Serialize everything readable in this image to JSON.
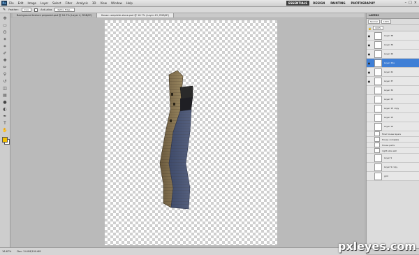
{
  "menubar": {
    "logo": "Ps",
    "items": [
      "File",
      "Edit",
      "Image",
      "Layer",
      "Select",
      "Filter",
      "Analysis",
      "3D",
      "View",
      "Window",
      "Help"
    ],
    "workspaces": [
      "ESSENTIALS",
      "DESIGN",
      "PAINTING",
      "PHOTOGRAPHY"
    ],
    "active_workspace": "ESSENTIALS",
    "window_buttons": [
      "–",
      "□",
      "×"
    ]
  },
  "options": {
    "feather_label": "Feather:",
    "feather_value": "0 px",
    "antialias_label": "Anti-alias",
    "refine_label": "Refine Edge..."
  },
  "tabs": [
    "Background texture prepared.psd @ 16.7% (Layer 4, RGB/8*)",
    "House complete alone.psd @ 16.7% (Layer 43, RGB/8*)"
  ],
  "status": {
    "zoom": "16.67%",
    "doc": "Doc: 24.0M/100.6M"
  },
  "panel": {
    "title": "LAYERS",
    "blend_mode": "Normal",
    "opacity": "100%",
    "fill": "100%",
    "layers": [
      {
        "name": "Layer 38",
        "visible": true,
        "selected": false,
        "short": false
      },
      {
        "name": "Layer 39",
        "visible": true,
        "selected": false,
        "short": false
      },
      {
        "name": "Layer 40",
        "visible": true,
        "selected": false,
        "short": false
      },
      {
        "name": "Layer 40a",
        "visible": true,
        "selected": true,
        "short": false
      },
      {
        "name": "Layer 41",
        "visible": true,
        "selected": false,
        "short": false
      },
      {
        "name": "Layer 37",
        "visible": true,
        "selected": false,
        "short": false
      },
      {
        "name": "Layer 32",
        "visible": false,
        "selected": false,
        "short": false
      },
      {
        "name": "Layer 33",
        "visible": false,
        "selected": false,
        "short": false
      },
      {
        "name": "Layer 15 copy",
        "visible": false,
        "selected": false,
        "short": false
      },
      {
        "name": "Layer 15",
        "visible": false,
        "selected": false,
        "short": false
      },
      {
        "name": "Layer 14",
        "visible": false,
        "selected": false,
        "short": false
      },
      {
        "name": "Final house layers",
        "visible": false,
        "selected": false,
        "short": true
      },
      {
        "name": "House complete",
        "visible": false,
        "selected": false,
        "short": true
      },
      {
        "name": "House parts",
        "visible": false,
        "selected": false,
        "short": true
      },
      {
        "name": "right side wall",
        "visible": false,
        "selected": false,
        "short": true
      },
      {
        "name": "Layer 9",
        "visible": false,
        "selected": false,
        "short": false
      },
      {
        "name": "Layer 9 copy",
        "visible": false,
        "selected": false,
        "short": false
      },
      {
        "name": "grid",
        "visible": false,
        "selected": false,
        "short": false
      }
    ]
  },
  "watermark": "pxleyes.com"
}
